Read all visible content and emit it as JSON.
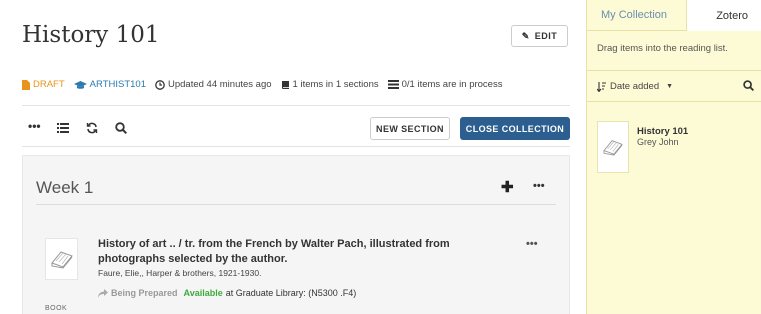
{
  "collection": {
    "title": "History 101",
    "edit_label": "EDIT",
    "meta": {
      "status": "DRAFT",
      "course_code": "ARTHIST101",
      "updated": "Updated 44 minutes ago",
      "items_summary": "1 items in 1 sections",
      "process_summary": "0/1 items are in process"
    }
  },
  "toolbar": {
    "new_section_label": "NEW SECTION",
    "close_collection_label": "CLOSE COLLECTION"
  },
  "sections": [
    {
      "title": "Week 1",
      "items": [
        {
          "title": "History of art .. / tr. from the French by Walter Pach, illustrated from photographs selected by the author.",
          "byline": "Faure, Elie,, Harper & brothers, 1921-1930.",
          "status_label": "Being Prepared",
          "availability": "Available",
          "location": "at Graduate Library: (N5300 .F4)",
          "type": "BOOK"
        }
      ]
    }
  ],
  "sidebar": {
    "tabs": [
      {
        "label": "My Collection",
        "active": false
      },
      {
        "label": "Zotero",
        "active": true
      }
    ],
    "hint": "Drag items into the reading list.",
    "sort_label": "Date added",
    "items": [
      {
        "title": "History 101",
        "author": "Grey John"
      }
    ]
  },
  "colors": {
    "primary_button": "#2c5f8f",
    "draft": "#e8941a",
    "course": "#2b7bb0",
    "available": "#3cab3c",
    "sidebar_bg": "#fdfbd6"
  }
}
